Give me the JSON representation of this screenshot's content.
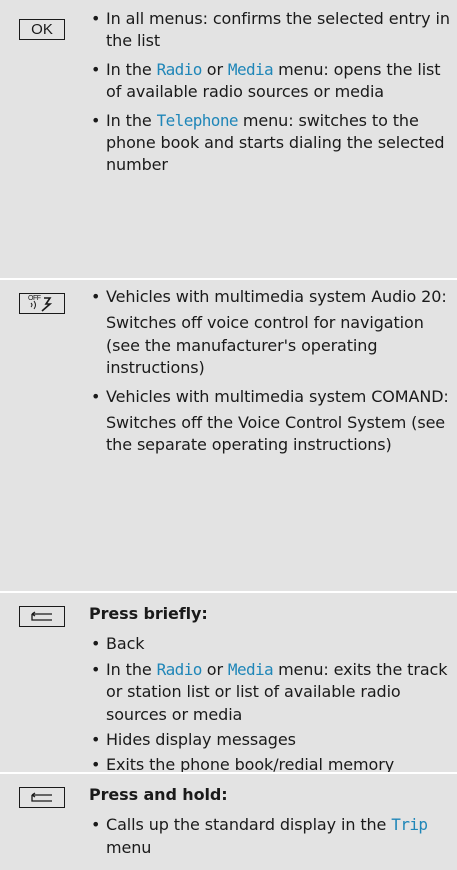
{
  "rows": [
    {
      "key": "OK",
      "items": [
        {
          "text": "In all menus: confirms the selected entry in the list"
        },
        {
          "pre": "In the ",
          "hl1": "Radio",
          "mid": " or ",
          "hl2": "Media",
          "post": " menu: opens the list of available radio sources or media"
        },
        {
          "pre": "In the ",
          "hl1": "Telephone",
          "post": " menu: switches to the phone book and starts dialing the selected number"
        }
      ]
    },
    {
      "key_icon": "voice-control-off-icon",
      "key_label": "OFF",
      "items": [
        {
          "text": "Vehicles with multimedia system Audio 20:",
          "sub": "Switches off voice control for navigation (see the manufacturer's operating instructions)"
        },
        {
          "text": "Vehicles with multimedia system COMAND:",
          "sub": "Switches off the Voice Control System (see the separate operating instructions)"
        }
      ]
    },
    {
      "key_icon": "back-icon",
      "heading": "Press briefly:",
      "items": [
        {
          "text": "Back"
        },
        {
          "pre": "In the ",
          "hl1": "Radio",
          "mid": " or ",
          "hl2": "Media",
          "post": " menu: exits the track or station list or list of available radio sources or media"
        },
        {
          "text": "Hides display messages"
        },
        {
          "text": "Exits the phone book/redial memory"
        }
      ]
    },
    {
      "key_icon": "back-icon",
      "heading": "Press and hold:",
      "items": [
        {
          "pre": "Calls up the standard display in the ",
          "hl1": "Trip",
          "post": " menu"
        }
      ]
    }
  ],
  "colors": {
    "background": "#e3e3e3",
    "separator": "#ffffff",
    "highlight": "#1f86b8",
    "text": "#1a1a1a"
  }
}
